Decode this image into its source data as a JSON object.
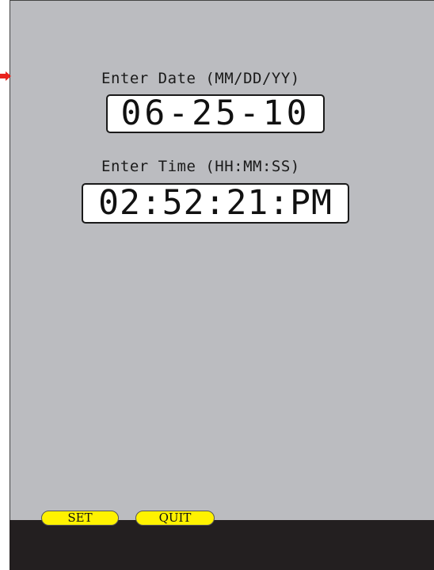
{
  "date_section": {
    "label": "Enter Date (MM/DD/YY)",
    "value": "06-25-10"
  },
  "time_section": {
    "label": "Enter Time (HH:MM:SS)",
    "value": "02:52:21:PM"
  },
  "buttons": {
    "set_label": "SET",
    "quit_label": "QUIT"
  },
  "colors": {
    "screen_background": "#bbbcc0",
    "bottom_bar": "#231f20",
    "button_fill": "#fff200",
    "pointer": "#e8231d"
  },
  "icons": {
    "pointer": "red-arrow-pointer-icon"
  }
}
